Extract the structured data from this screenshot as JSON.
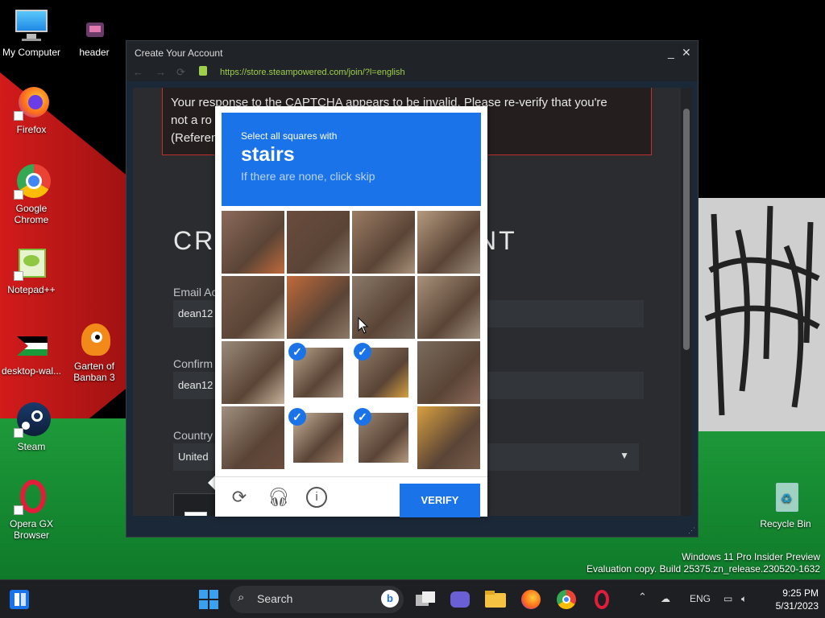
{
  "desktop": {
    "icons": [
      {
        "label": "My Computer"
      },
      {
        "label": "header"
      },
      {
        "label": "Firefox"
      },
      {
        "label": "Google Chrome"
      },
      {
        "label": "Notepad++"
      },
      {
        "label": "desktop-wal..."
      },
      {
        "label": "Garten of Banban 3"
      },
      {
        "label": "Steam"
      },
      {
        "label": "Opera GX Browser"
      },
      {
        "label": "Recycle Bin"
      }
    ],
    "watermark": {
      "line1": "Windows 11 Pro Insider Preview",
      "line2": "Evaluation copy. Build 25375.zn_release.230520-1632"
    }
  },
  "window": {
    "title": "Create Your Account",
    "url": "https://store.steampowered.com/join/?l=english",
    "error": {
      "line1": "Your response to the CAPTCHA appears to be invalid. Please re-verify that you're",
      "line2": "not a ro",
      "line3": "(Referen"
    },
    "heading_left": "CR",
    "heading_right": "NT",
    "email_label": "Email Ac",
    "email_value": "dean12",
    "confirm_label": "Confirm",
    "confirm_value": "dean12",
    "country_label": "Country",
    "country_value": "United"
  },
  "captcha": {
    "instruction": "Select all squares with",
    "target": "stairs",
    "hint": "If there are none, click skip",
    "verify_label": "VERIFY",
    "selected_cells": [
      9,
      10,
      13,
      14
    ],
    "colors": {
      "accent": "#1a73e8"
    }
  },
  "taskbar": {
    "search_placeholder": "Search",
    "lang": "ENG",
    "time": "9:25 PM",
    "date": "5/31/2023"
  }
}
